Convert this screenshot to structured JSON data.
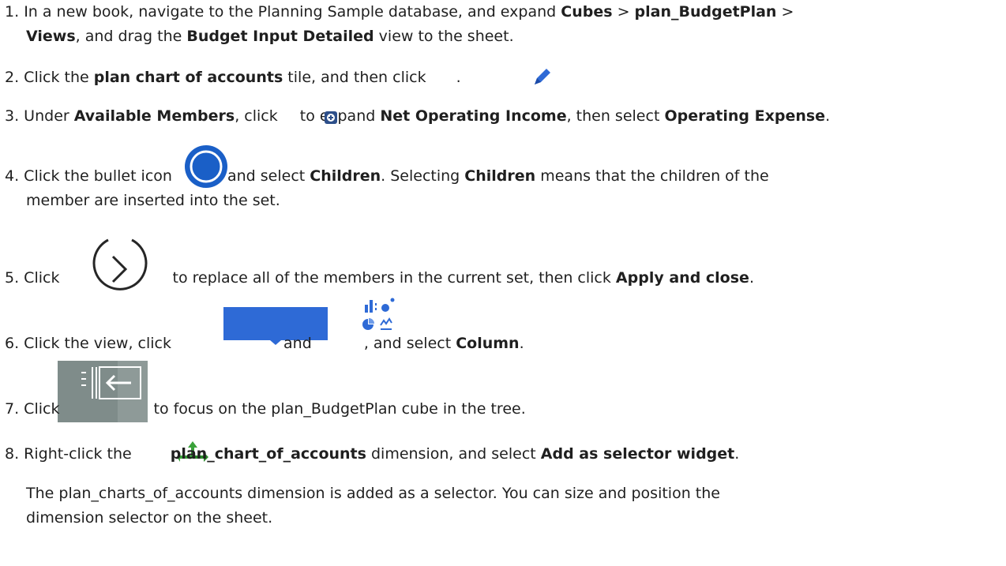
{
  "steps": [
    {
      "n": "1.",
      "a": "In a new book, navigate to the Planning Sample database, and expand ",
      "b1": "Cubes",
      "c": " > ",
      "b2": "plan_BudgetPlan",
      "d": " >",
      "l2b1": "Views",
      "l2c": ", and drag the ",
      "l2b2": "Budget Input Detailed",
      "l2d": " view to the sheet."
    },
    {
      "n": "2.",
      "a": " Click the ",
      "b1": "plan chart of accounts",
      "c": " tile, and then click",
      "d": " ."
    },
    {
      "n": "3.",
      "a": " Under ",
      "b1": "Available Members",
      "c": ", click",
      "d": " to expand ",
      "b2": "Net Operating Income",
      "e": ", then select ",
      "b3": "Operating Expense",
      "f": "."
    },
    {
      "n": "4.",
      "a": " Click the bullet icon",
      "c": " and select ",
      "b1": "Children",
      "d": ". Selecting ",
      "b2": "Children",
      "e": " means that the children of the",
      "l2": "member are inserted into the set."
    },
    {
      "n": "5.",
      "a": " Click",
      "c": " to replace all of the members in the current set, then click ",
      "b1": "Apply and close",
      "d": "."
    },
    {
      "n": "6.",
      "a": " Click the view, click",
      "c": " and",
      "d": " , and select ",
      "b1": "Column",
      "e": "."
    },
    {
      "n": "7.",
      "a": " Click",
      "c": " to focus on the plan_BudgetPlan cube in the tree."
    },
    {
      "n": "8.",
      "a": " Right-click the",
      "b1": "plan_chart_of_accounts",
      "c": " dimension, and select ",
      "b2": "Add as selector widget",
      "d": "."
    }
  ],
  "note": {
    "l1": "The plan_charts_of_accounts dimension is added as a selector. You can size and position the",
    "l2": "dimension selector on the sheet."
  },
  "icons": [
    "edit-pencil-icon",
    "expand-plus-icon",
    "bullet-circle-icon",
    "replace-arrow-icon",
    "dropdown-button-icon",
    "chart-types-icon",
    "focus-tree-icon",
    "dimension-icon"
  ],
  "colors": {
    "text": "#1f1f1f",
    "blue": "#2e6ad6",
    "grey": "#7f8c8a",
    "green": "#3aa23a"
  }
}
